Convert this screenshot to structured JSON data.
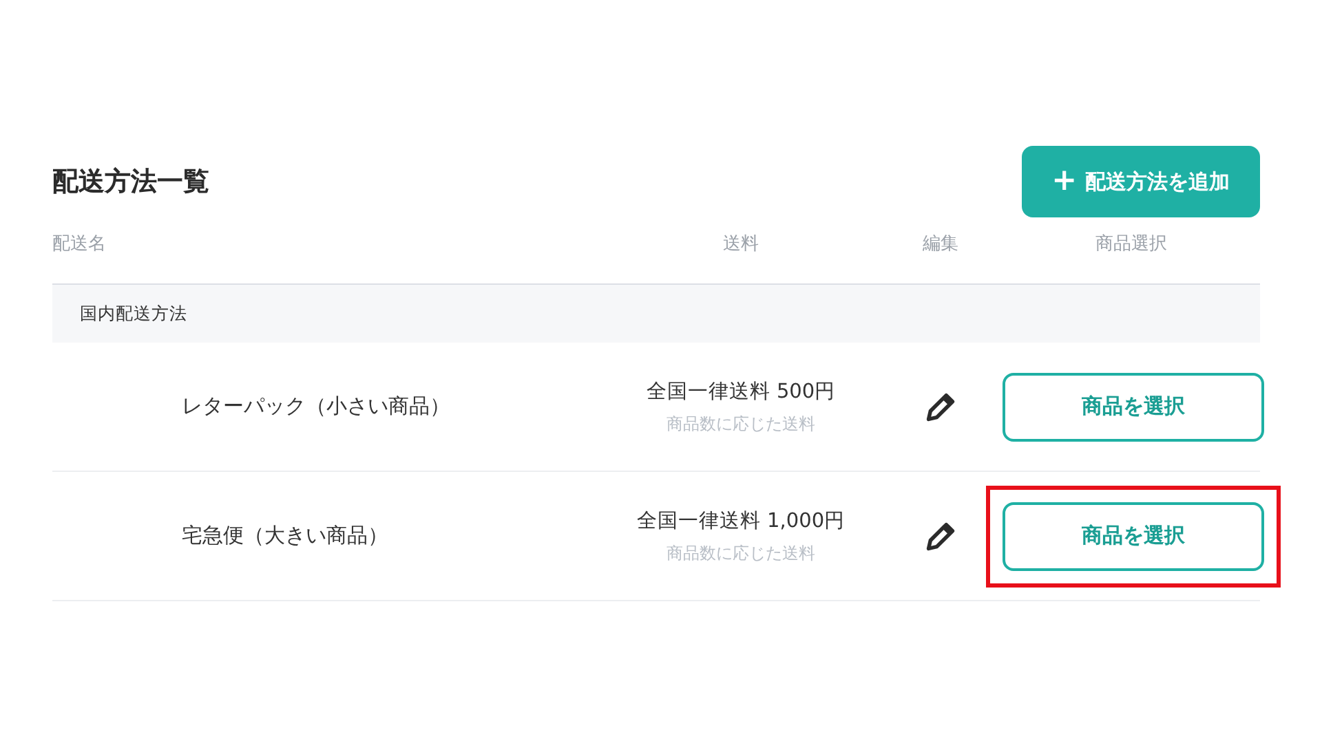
{
  "title": "配送方法一覧",
  "add_button": {
    "icon": "+",
    "label": "配送方法を追加"
  },
  "table": {
    "columns": [
      "配送名",
      "送料",
      "編集",
      "商品選択"
    ],
    "group": "国内配送方法",
    "rows": [
      {
        "name": "レターパック（小さい商品）",
        "fee": "全国一律送料 500円",
        "fee_note": "商品数に応じた送料",
        "action": "商品を選択",
        "highlighted": false
      },
      {
        "name": "宅急便（大きい商品）",
        "fee": "全国一律送料 1,000円",
        "fee_note": "商品数に応じた送料",
        "action": "商品を選択",
        "highlighted": true
      }
    ]
  }
}
